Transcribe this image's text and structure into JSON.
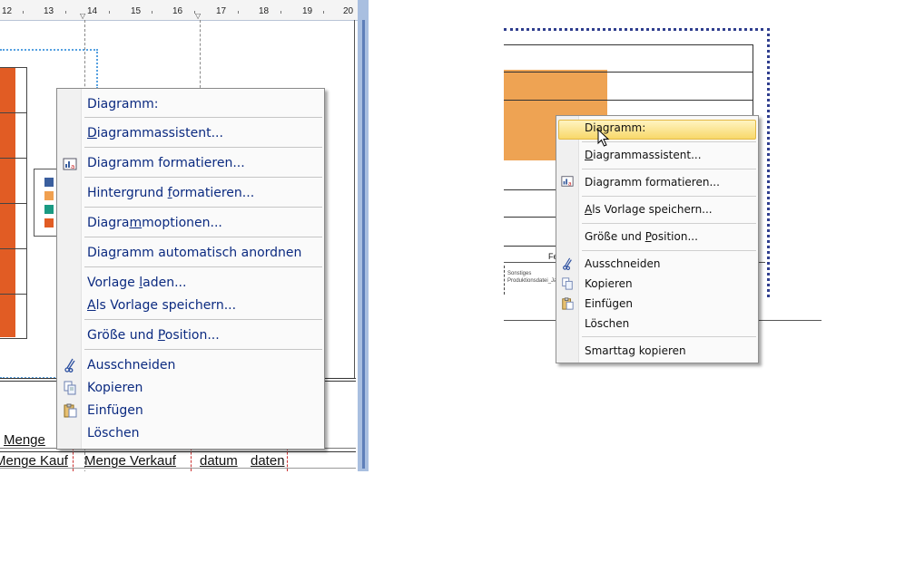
{
  "left": {
    "ruler_numbers": [
      "12",
      "13",
      "14",
      "15",
      "16",
      "17",
      "18",
      "19",
      "20"
    ],
    "doc_fragments": {
      "menge_label": "Menge",
      "row_texts": [
        "Menge  Kauf",
        "Menge  Verkauf",
        "datum",
        "daten"
      ]
    },
    "legend_colors": [
      "#3b5f9e",
      "#f0a050",
      "#1a9a82",
      "#e15c24"
    ],
    "context_menu": {
      "items": [
        {
          "pre": "Diagramm:",
          "u": "",
          "post": ""
        },
        {
          "pre": "",
          "u": "D",
          "post": "iagrammassistent..."
        },
        {
          "pre": "Diagramm formatieren...",
          "u": "",
          "post": ""
        },
        {
          "pre": "Hintergrund ",
          "u": "f",
          "post": "ormatieren..."
        },
        {
          "pre": "Diagra",
          "u": "m",
          "post": "moptionen..."
        },
        {
          "pre": "Dia",
          "u": "g",
          "post": "ramm automatisch anordnen"
        },
        {
          "pre": "Vorlage ",
          "u": "l",
          "post": "aden..."
        },
        {
          "pre": "",
          "u": "A",
          "post": "ls Vorlage speichern..."
        },
        {
          "pre": "Größe und ",
          "u": "P",
          "post": "osition..."
        },
        {
          "pre": "Ausschneiden",
          "u": "",
          "post": ""
        },
        {
          "pre": "Kopieren",
          "u": "",
          "post": ""
        },
        {
          "pre": "Einfügen",
          "u": "",
          "post": ""
        },
        {
          "pre": "Löschen",
          "u": "",
          "post": ""
        }
      ]
    }
  },
  "right": {
    "tiny_label": "Fe",
    "tiny_footer": [
      "Sonstiges",
      "Produktionsdatei_Jan"
    ],
    "context_menu": {
      "items": [
        {
          "pre": "Diagramm:",
          "u": "",
          "post": ""
        },
        {
          "pre": "",
          "u": "D",
          "post": "iagrammassistent..."
        },
        {
          "pre": "Diagramm formatieren...",
          "u": "",
          "post": ""
        },
        {
          "pre": "",
          "u": "A",
          "post": "ls Vorlage speichern..."
        },
        {
          "pre": "Größe und ",
          "u": "P",
          "post": "osition..."
        },
        {
          "pre": "Ausschneiden",
          "u": "",
          "post": ""
        },
        {
          "pre": "Kopieren",
          "u": "",
          "post": ""
        },
        {
          "pre": "Einfügen",
          "u": "",
          "post": ""
        },
        {
          "pre": "Löschen",
          "u": "",
          "post": ""
        },
        {
          "pre": "Smarttag kopieren",
          "u": "",
          "post": ""
        }
      ]
    }
  },
  "icons": {
    "format": "chart-format-icon",
    "cut": "scissors-icon",
    "copy": "copy-icon",
    "paste": "paste-icon",
    "cursor": "mouse-pointer-icon"
  },
  "colors": {
    "menu_text_left": "#0b2a80",
    "orange_left": "#e15c24",
    "orange_right": "#eea353",
    "highlight": "#f8d86a"
  }
}
